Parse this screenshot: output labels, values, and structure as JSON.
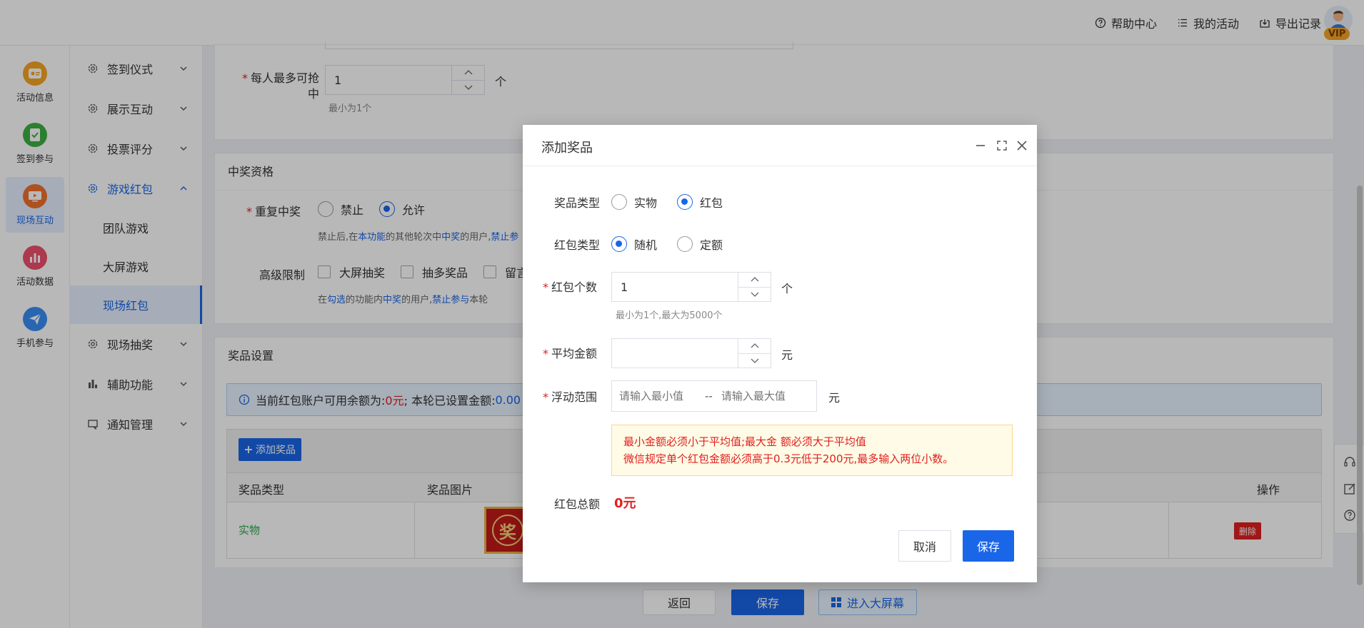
{
  "topbar": {
    "help_center": "帮助中心",
    "my_activities": "我的活动",
    "export_records": "导出记录",
    "vip_badge": "VIP"
  },
  "rail": {
    "items": [
      {
        "label": "活动信息",
        "icon": "activity-info-icon",
        "color": "#f5a623"
      },
      {
        "label": "签到参与",
        "icon": "checkin-icon",
        "color": "#3cb043"
      },
      {
        "label": "现场互动",
        "icon": "live-interaction-icon",
        "color": "#f0712f"
      },
      {
        "label": "活动数据",
        "icon": "activity-data-icon",
        "color": "#f0506e"
      },
      {
        "label": "手机参与",
        "icon": "mobile-participation-icon",
        "color": "#3a8ef6"
      }
    ]
  },
  "submenu": {
    "items": [
      {
        "label": "签到仪式"
      },
      {
        "label": "展示互动"
      },
      {
        "label": "投票评分"
      },
      {
        "label": "游戏红包"
      },
      {
        "label": "团队游戏"
      },
      {
        "label": "大屏游戏"
      },
      {
        "label": "现场红包"
      },
      {
        "label": "现场抽奖"
      },
      {
        "label": "辅助功能"
      },
      {
        "label": "通知管理"
      }
    ]
  },
  "main": {
    "max_win_label": "每人最多可抢中",
    "max_win_value": "1",
    "max_win_unit": "个",
    "max_win_hint": "最小为1个",
    "eligibility_title": "中奖资格",
    "repeat_win_label": "重复中奖",
    "repeat_forbid": "禁止",
    "repeat_allow": "允许",
    "repeat_hint_a": "禁止后,在",
    "repeat_hint_b": "本功能",
    "repeat_hint_c": "的其他轮次中",
    "repeat_hint_d": "中奖",
    "repeat_hint_e": "的用户,",
    "repeat_hint_f": "禁止参",
    "advanced_label": "高级限制",
    "adv_opt1": "大屏抽奖",
    "adv_opt2": "抽多奖品",
    "adv_opt3": "留言",
    "adv_hint_a": "在",
    "adv_hint_b": "勾选",
    "adv_hint_c": "的功能内",
    "adv_hint_d": "中奖",
    "adv_hint_e": "的用户,",
    "adv_hint_f": "禁止参与",
    "adv_hint_g": "本轮",
    "prize_settings_title": "奖品设置",
    "balance_a": "当前红包账户可用余额为:",
    "balance_value": "0元",
    "balance_b": "; 本轮已设置金额:",
    "balance_c": "0.00",
    "add_prize_btn": "添加奖品",
    "col_prize_type": "奖品类型",
    "col_prize_image": "奖品图片",
    "col_action": "操作",
    "row_type": "实物",
    "row_image_char": "奖",
    "row_delete": "删除",
    "footer_back": "返回",
    "footer_save": "保存",
    "footer_enter_screen": "进入大屏幕"
  },
  "dialog": {
    "title": "添加奖品",
    "prize_type_label": "奖品类型",
    "prize_type_physical": "实物",
    "prize_type_redpacket": "红包",
    "rp_type_label": "红包类型",
    "rp_type_random": "随机",
    "rp_type_fixed": "定额",
    "rp_count_label": "红包个数",
    "rp_count_value": "1",
    "rp_count_unit": "个",
    "rp_count_hint": "最小为1个,最大为5000个",
    "avg_amount_label": "平均金额",
    "avg_amount_value": "",
    "avg_amount_unit": "元",
    "range_label": "浮动范围",
    "range_min_placeholder": "请输入最小值",
    "range_sep": "--",
    "range_max_placeholder": "请输入最大值",
    "range_unit": "元",
    "warn_line1": "最小金额必须小于平均值;最大金 额必须大于平均值",
    "warn_line2": "微信规定单个红包金额必须高于0.3元低于200元,最多输入两位小数。",
    "total_label": "红包总额",
    "total_value": "0元",
    "cancel": "取消",
    "save": "保存"
  },
  "colors": {
    "primary": "#1a66e8",
    "danger": "#e02020",
    "success": "#2aa84a"
  }
}
